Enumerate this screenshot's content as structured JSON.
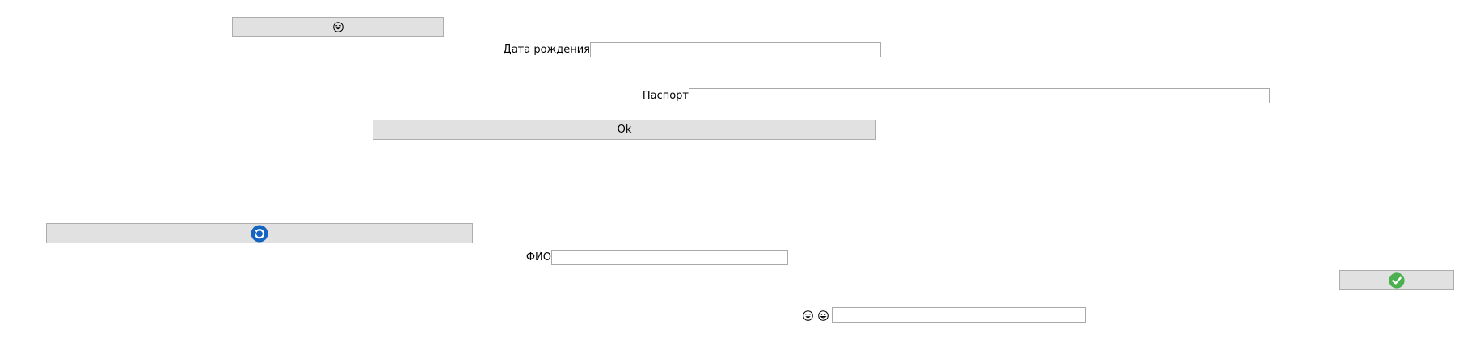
{
  "buttons": {
    "top_emoji": {
      "icon": "laughing-face-icon"
    },
    "ok": {
      "label": "Ok"
    },
    "refresh": {
      "icon": "blue-refresh-icon",
      "color": "#1565c0"
    },
    "confirm": {
      "icon": "green-check-icon",
      "color": "#4caf50"
    }
  },
  "fields": {
    "birth_date": {
      "label": "Дата рождения",
      "value": ""
    },
    "passport": {
      "label": "Паспорт",
      "value": ""
    },
    "full_name": {
      "label": "ФИО",
      "value": ""
    },
    "emoji_input": {
      "value": "",
      "icons": [
        "laughing-face-icon",
        "grinning-face-icon"
      ]
    }
  },
  "colors": {
    "button_bg": "#e1e1e1",
    "button_border": "#adadad",
    "field_border": "#a9a9a9"
  }
}
